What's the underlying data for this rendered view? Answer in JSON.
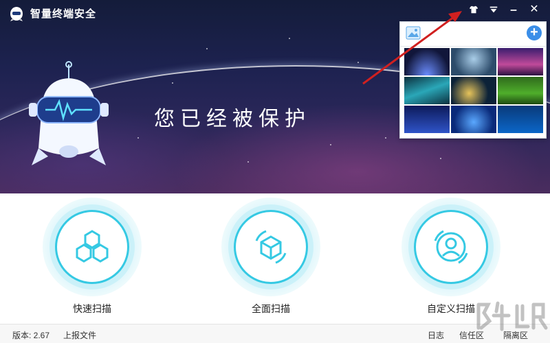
{
  "app": {
    "title": "智量终端安全"
  },
  "window_controls": {
    "skin": "skin-shirt-icon",
    "menu": "menu-icon",
    "minimize": "—",
    "close": "✕"
  },
  "hero": {
    "slogan": "您已经被保护"
  },
  "skin_panel": {
    "add_label": "+"
  },
  "actions": [
    {
      "label": "快速扫描"
    },
    {
      "label": "全面扫描"
    },
    {
      "label": "自定义扫描"
    }
  ],
  "status": {
    "version": "版本: 2.67",
    "report": "上报文件",
    "log": "日志",
    "trust": "信任区",
    "quarantine": "隔离区"
  },
  "colors": {
    "accent": "#35c9e3",
    "hero_dark": "#1d2250",
    "red_arrow": "#d02020"
  }
}
